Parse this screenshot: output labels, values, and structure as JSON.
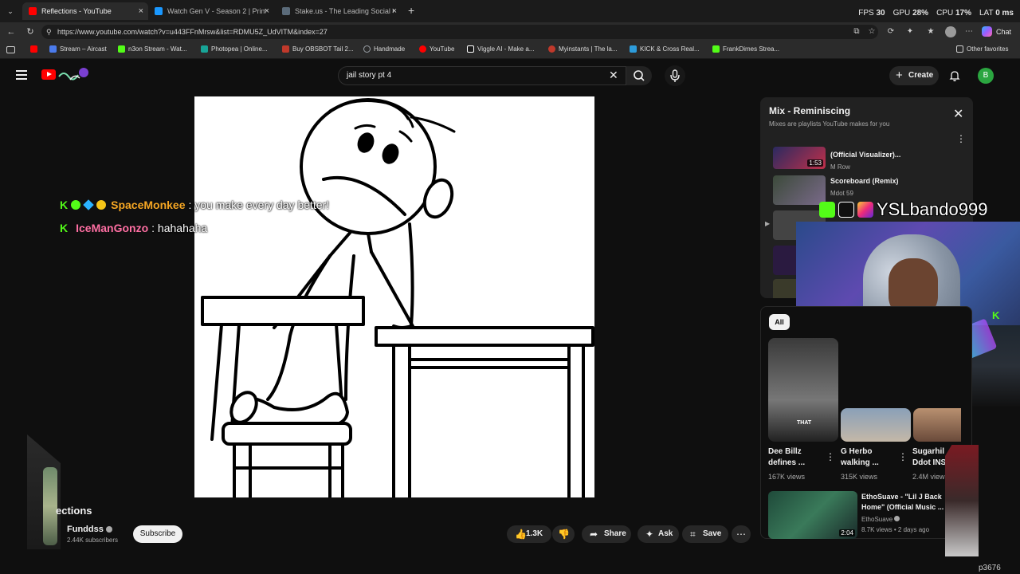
{
  "browser": {
    "tabs": [
      {
        "label": "Reflections - YouTube",
        "active": true,
        "color": "#ff0000"
      },
      {
        "label": "Watch Gen V - Season 2 | Prime V",
        "active": false,
        "color": "#1a98ff"
      },
      {
        "label": "Stake.us - The Leading Social Casi",
        "active": false,
        "color": "#5b6b7a"
      }
    ],
    "stats": {
      "fps_label": "FPS",
      "fps": "30",
      "gpu_label": "GPU",
      "gpu": "28%",
      "cpu_label": "CPU",
      "cpu": "17%",
      "lat_label": "LAT",
      "lat": "0 ms"
    },
    "url": "https://www.youtube.com/watch?v=u443FFnMrsw&list=RDMU5Z_UdVITM&index=27",
    "chat_label": "Chat",
    "favorites": [
      {
        "label": "",
        "color": "#ff0000"
      },
      {
        "label": "Stream – Aircast",
        "color": "#4b7bec"
      },
      {
        "label": "n3on Stream - Wat...",
        "color": "#53fc18"
      },
      {
        "label": "Photopea | Online...",
        "color": "#18a497"
      },
      {
        "label": "Buy OBSBOT Tail 2...",
        "color": "#c0392b"
      },
      {
        "label": "Handmade",
        "color": "#9aa0a6"
      },
      {
        "label": "YouTube",
        "color": "#ff0000"
      },
      {
        "label": "Viggle AI - Make a...",
        "color": "#ffffff"
      },
      {
        "label": "Myinstants | The la...",
        "color": "#c0392b"
      },
      {
        "label": "KICK & Cross Real...",
        "color": "#2d9cdb"
      },
      {
        "label": "FrankDimes Strea...",
        "color": "#53fc18"
      }
    ],
    "other_favorites": "Other favorites"
  },
  "youtube": {
    "search_query": "jail story pt 4",
    "create_label": "Create",
    "avatar_letter": "B"
  },
  "chat": [
    {
      "user": "SpaceMonkee",
      "user_color": "#f5a623",
      "message": ": you make every day better!"
    },
    {
      "user": "IceManGonzo",
      "user_color": "#ff6fa3",
      "message": ": hahahaha"
    }
  ],
  "video_info": {
    "title_fragment": "ections",
    "channel": "Funddss",
    "subscribers": "2.44K subscribers",
    "subscribe_label": "Subscribe",
    "likes": "1.3K",
    "share_label": "Share",
    "ask_label": "Ask",
    "save_label": "Save"
  },
  "mix": {
    "title": "Mix - Reminiscing",
    "subtitle": "Mixes are playlists YouTube makes for you",
    "items": [
      {
        "title": "(Official Visualizer)...",
        "channel": "M Row",
        "duration": "1:53"
      },
      {
        "title": "Scoreboard (Remix)",
        "channel": "Mdot 59",
        "duration": ""
      }
    ]
  },
  "webcam": {
    "handle": "YSLbando999"
  },
  "recommendations": {
    "chip": "All",
    "items": [
      {
        "title1": "Dee Billz",
        "title2": "defines ...",
        "views": "167K views"
      },
      {
        "title1": "G Herbo",
        "title2": "walking ...",
        "views": "315K views"
      },
      {
        "title1": "Sugarhil",
        "title2": "Ddot INS",
        "views": "2.4M view"
      }
    ],
    "row": {
      "title1": "EthoSuave - \"Lil J Back",
      "title2": "Home\" (Official Music ...",
      "channel": "EthoSuave",
      "meta": "8.7K views • 2 days ago",
      "duration": "2:04"
    }
  },
  "watermark": "p3676"
}
